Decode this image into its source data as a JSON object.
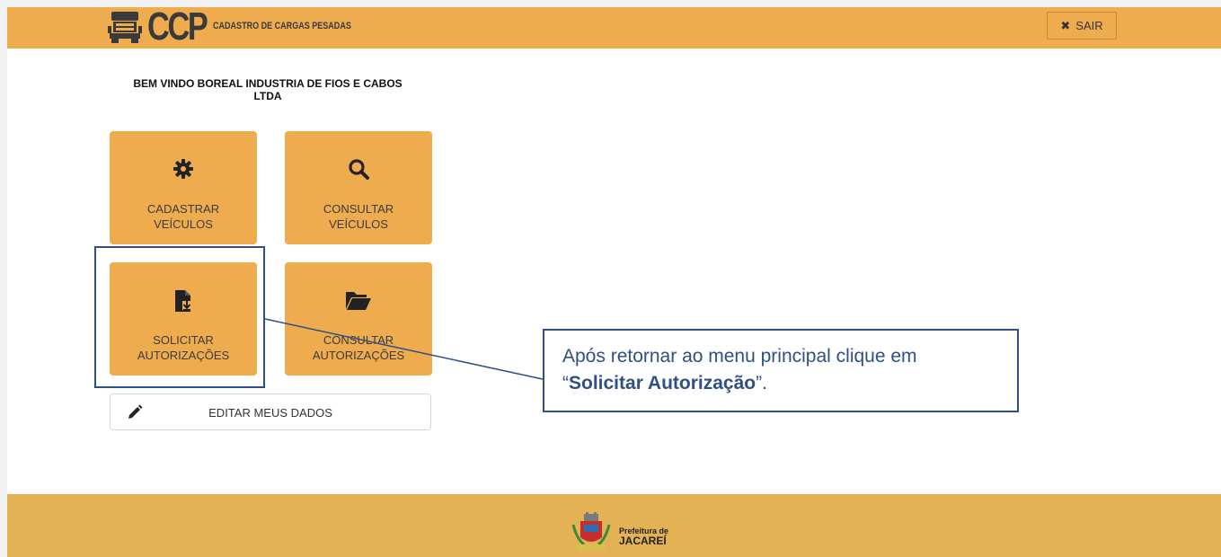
{
  "header": {
    "logo_text": "CCP",
    "app_name": "CADASTRO DE CARGAS PESADAS",
    "exit_label": "SAIR"
  },
  "welcome": {
    "line1": "BEM VINDO BOREAL INDUSTRIA DE FIOS E CABOS",
    "line2": "LTDA"
  },
  "tiles": [
    {
      "line1": "CADASTRAR",
      "line2": "VEÍCULOS",
      "icon": "gear-icon"
    },
    {
      "line1": "CONSULTAR",
      "line2": "VEÍCULOS",
      "icon": "search-icon"
    },
    {
      "line1": "SOLICITAR",
      "line2": "AUTORIZAÇÕES",
      "icon": "file-import-icon"
    },
    {
      "line1": "CONSULTAR",
      "line2": "AUTORIZAÇÕES",
      "icon": "folder-open-icon"
    }
  ],
  "edit_button": {
    "label": "EDITAR MEUS DADOS",
    "icon": "pencil-icon"
  },
  "callout": {
    "text_before": "Após retornar ao menu principal clique em “",
    "bold": "Solicitar Autorização",
    "text_after": "”."
  },
  "footer": {
    "org_line1": "Prefeitura de",
    "org_line2": "JACAREÍ"
  },
  "colors": {
    "accent": "#efac4e",
    "footer": "#e2b255",
    "callout_border": "#2f4f86"
  }
}
